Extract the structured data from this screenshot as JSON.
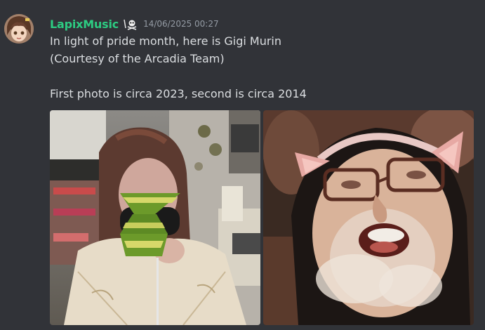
{
  "message": {
    "username": "LapixMusic",
    "role_icon": "skull-crossbones-icon",
    "timestamp": "14/06/2025 00:27",
    "lines": [
      "In light of pride month, here is Gigi Murin",
      "(Courtesy of the Arcadia Team)",
      "",
      "First photo is circa 2023, second is circa 2014"
    ],
    "attachments": [
      {
        "kind": "photo",
        "subject": "person-holding-green-toy"
      },
      {
        "kind": "photo",
        "subject": "person-with-cat-ears-and-glasses"
      }
    ]
  },
  "colors": {
    "background": "#313338",
    "username": "#2dcc82",
    "text": "#dbdee1",
    "timestamp": "#949ba4"
  }
}
